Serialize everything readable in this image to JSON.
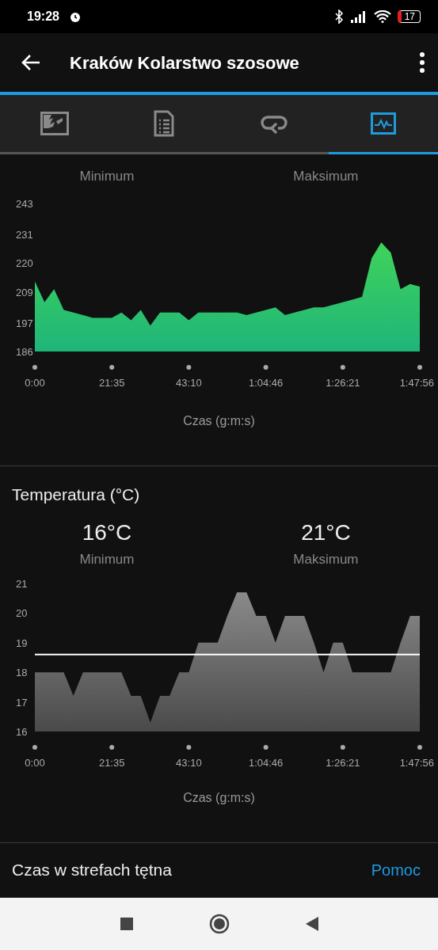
{
  "status_bar": {
    "time": "19:28",
    "battery": "17"
  },
  "app_bar": {
    "title": "Kraków Kolarstwo szosowe"
  },
  "tabs": [
    {
      "kind": "map",
      "selected": false
    },
    {
      "kind": "details",
      "selected": false
    },
    {
      "kind": "laps",
      "selected": false
    },
    {
      "kind": "charts",
      "selected": true
    }
  ],
  "sections": [
    {
      "stats": [
        {
          "label": "Minimum"
        },
        {
          "label": "Maksimum"
        }
      ],
      "chart_data": {
        "type": "area",
        "xlabel": "Czas (g:m:s)",
        "x": [
          0,
          162,
          324,
          486,
          648,
          810,
          971,
          1133,
          1295,
          1457,
          1619,
          1781,
          1943,
          2105,
          2267,
          2429,
          2590,
          2752,
          2914,
          3076,
          3238,
          3400,
          3562,
          3724,
          3886,
          4048,
          4209,
          4371,
          4533,
          4695,
          4857,
          5019,
          5181,
          5343,
          5505,
          5667,
          5828,
          5990,
          6152,
          6314,
          6476
        ],
        "xlim": [
          0,
          6476
        ],
        "series": [
          {
            "color": "#3fd35a",
            "values": [
              213,
              205,
              210,
              202,
              201,
              200,
              199,
              199,
              199,
              201,
              198,
              202,
              196,
              201,
              201,
              201,
              198,
              201,
              201,
              201,
              201,
              201,
              200,
              201,
              202,
              203,
              200,
              201,
              202,
              203,
              203,
              204,
              205,
              206,
              207,
              222,
              228,
              224,
              210,
              212,
              211
            ]
          }
        ],
        "ylim": [
          186,
          243
        ],
        "yticks": [
          186,
          197,
          209,
          220,
          231,
          243
        ],
        "xticks": [
          {
            "value": 0,
            "label": "0:00"
          },
          {
            "value": 1295,
            "label": "21:35"
          },
          {
            "value": 2590,
            "label": "43:10"
          },
          {
            "value": 3886,
            "label": "1:04:46"
          },
          {
            "value": 5181,
            "label": "1:26:21"
          },
          {
            "value": 6476,
            "label": "1:47:56"
          }
        ]
      }
    },
    {
      "title": "Temperatura (°C)",
      "stats": [
        {
          "value": "16°C",
          "label": "Minimum"
        },
        {
          "value": "21°C",
          "label": "Maksimum"
        }
      ],
      "chart_data": {
        "type": "area",
        "xlabel": "Czas (g:m:s)",
        "x": [
          0,
          162,
          324,
          486,
          648,
          810,
          971,
          1133,
          1295,
          1457,
          1619,
          1781,
          1943,
          2105,
          2267,
          2429,
          2590,
          2752,
          2914,
          3076,
          3238,
          3400,
          3562,
          3724,
          3886,
          4048,
          4209,
          4371,
          4533,
          4695,
          4857,
          5019,
          5181,
          5343,
          5505,
          5667,
          5828,
          5990,
          6152,
          6314,
          6476
        ],
        "xlim": [
          0,
          6476
        ],
        "series": [
          {
            "color": "#8a8a8a",
            "values": [
              18,
              18,
              18,
              18,
              17.2,
              18,
              18,
              18,
              18,
              18,
              17.2,
              17.2,
              16.3,
              17.2,
              17.2,
              18,
              18,
              19,
              19,
              19,
              19.9,
              20.7,
              20.7,
              19.9,
              19.9,
              19,
              19.9,
              19.9,
              19.9,
              19,
              18,
              19,
              19,
              18,
              18,
              18,
              18,
              18,
              19,
              19.9,
              19.9
            ]
          }
        ],
        "ylim": [
          16,
          21
        ],
        "yticks": [
          16,
          17,
          18,
          19,
          20,
          21
        ],
        "xticks": [
          {
            "value": 0,
            "label": "0:00"
          },
          {
            "value": 1295,
            "label": "21:35"
          },
          {
            "value": 2590,
            "label": "43:10"
          },
          {
            "value": 3886,
            "label": "1:04:46"
          },
          {
            "value": 5181,
            "label": "1:26:21"
          },
          {
            "value": 6476,
            "label": "1:47:56"
          }
        ],
        "ref_lines": [
          {
            "axis": "y",
            "value": 18.6
          }
        ]
      }
    }
  ],
  "footer": {
    "title": "Czas w strefach tętna",
    "link": "Pomoc"
  }
}
